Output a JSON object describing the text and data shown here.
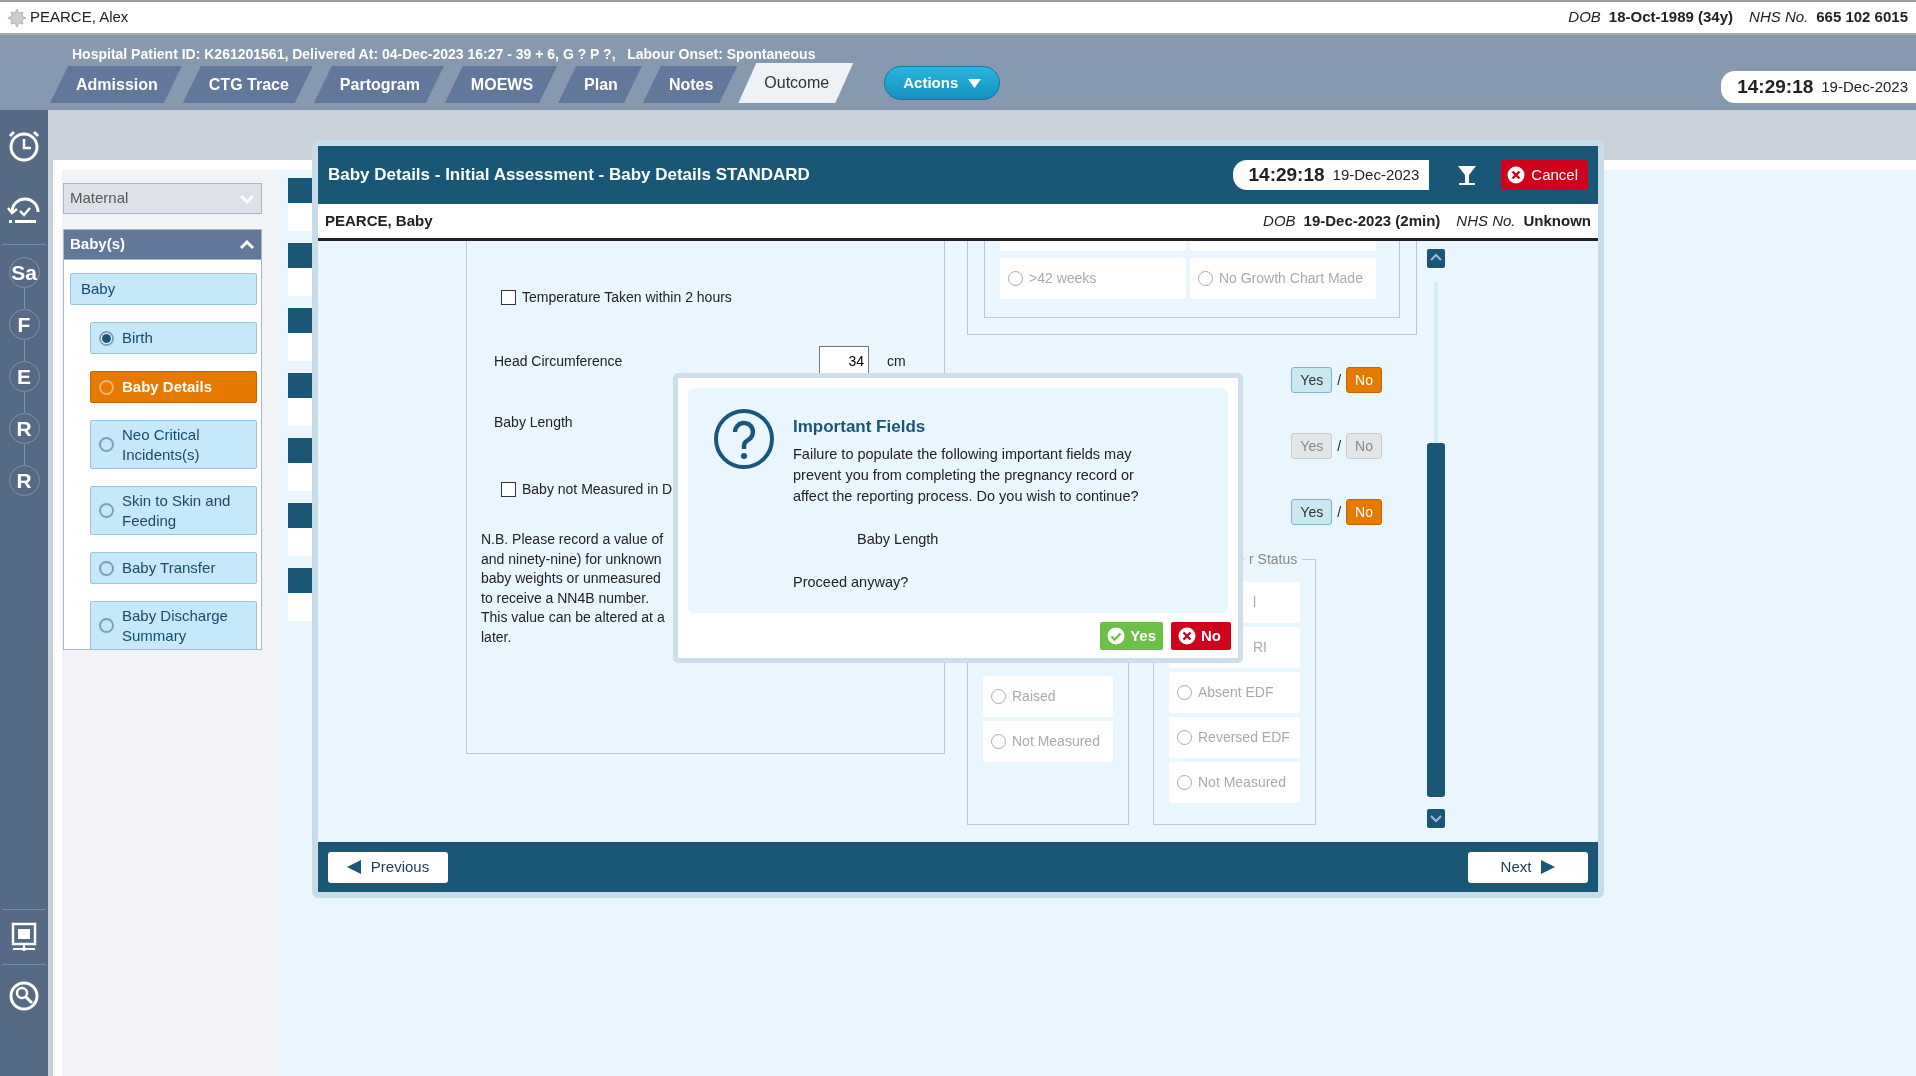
{
  "patient_bar": {
    "name": "PEARCE, Alex",
    "dob_label": "DOB",
    "dob": "18-Oct-1989 (34y)",
    "nhs_label": "NHS No.",
    "nhs": "665 102 6015"
  },
  "header": {
    "info": "Hospital Patient ID: K261201561, Delivered At: 04-Dec-2023 16:27 - 39 + 6, G ? P ?,   Labour Onset: Spontaneous",
    "tabs": [
      {
        "label": "Admission",
        "selected": false
      },
      {
        "label": "CTG Trace",
        "selected": false
      },
      {
        "label": "Partogram",
        "selected": false
      },
      {
        "label": "MOEWS",
        "selected": false
      },
      {
        "label": "Plan",
        "selected": false
      },
      {
        "label": "Notes",
        "selected": false
      },
      {
        "label": "Outcome",
        "selected": true
      }
    ],
    "actions": "Actions",
    "clock": {
      "time": "14:29:18",
      "date": "19-Dec-2023"
    }
  },
  "rail": {
    "steps": [
      "Sa",
      "F",
      "E",
      "R",
      "R"
    ]
  },
  "nav": {
    "sections": [
      {
        "label": "Maternal",
        "expanded": false
      },
      {
        "label": "Baby(s)",
        "expanded": true
      }
    ],
    "group": "Baby",
    "items": [
      {
        "label": "Birth",
        "checked": true,
        "selected": false
      },
      {
        "label": "Baby Details",
        "checked": false,
        "selected": true
      },
      {
        "label": "Neo Critical Incidents(s)",
        "checked": false,
        "selected": false
      },
      {
        "label": "Skin to Skin and Feeding",
        "checked": false,
        "selected": false
      },
      {
        "label": "Baby Transfer",
        "checked": false,
        "selected": false
      },
      {
        "label": "Baby Discharge Summary",
        "checked": false,
        "selected": false
      }
    ]
  },
  "wizard": {
    "title": "Baby Details - Initial Assessment - Baby Details STANDARD",
    "clock": {
      "time": "14:29:18",
      "date": "19-Dec-2023"
    },
    "cancel": "Cancel",
    "baby": {
      "name": "PEARCE, Baby",
      "dob_label": "DOB",
      "dob": "19-Dec-2023 (2min)",
      "nhs_label": "NHS No.",
      "nhs": "Unknown"
    },
    "form": {
      "temperature": {
        "label": "Temperature Taken within 2 hours",
        "checked": false
      },
      "head": {
        "label": "Head Circumference",
        "value": "34",
        "unit": "cm"
      },
      "length": {
        "label": "Baby Length"
      },
      "not_measured": {
        "label": "Baby not Measured in D",
        "checked": false
      },
      "note": [
        "N.B. Please record a value of",
        "and ninety-nine) for unknown",
        "baby weights or unmeasured",
        "to receive a NN4B number.",
        "This value can be altered at a",
        "later."
      ]
    },
    "growth_options": [
      {
        "label": ">42 weeks",
        "selected": false
      },
      {
        "label": "No Growth Chart Made",
        "selected": false
      }
    ],
    "toggles": [
      {
        "disabled": false,
        "separator": "/",
        "options": [
          {
            "label": "Yes",
            "selected": false
          },
          {
            "label": "No",
            "selected": true
          }
        ]
      },
      {
        "disabled": true,
        "separator": "/",
        "options": [
          {
            "label": "Yes",
            "selected": false
          },
          {
            "label": "No",
            "selected": false
          }
        ]
      },
      {
        "disabled": false,
        "separator": "/",
        "options": [
          {
            "label": "Yes",
            "selected": false
          },
          {
            "label": "No",
            "selected": true
          }
        ]
      }
    ],
    "group_a": {
      "options": [
        {
          "label": "Raised",
          "selected": false
        },
        {
          "label": "Not Measured",
          "selected": false
        }
      ]
    },
    "group_b": {
      "legend": "r Status",
      "options": [
        {
          "label": "l",
          "kind": "partial",
          "selected": false
        },
        {
          "label": "RI",
          "kind": "partial",
          "selected": false
        },
        {
          "label": "Absent EDF",
          "kind": "full",
          "selected": false
        },
        {
          "label": "Reversed EDF",
          "kind": "full",
          "selected": false
        },
        {
          "label": "Not Measured",
          "kind": "full",
          "selected": false
        }
      ]
    },
    "previous": "Previous",
    "next": "Next"
  },
  "dialog": {
    "title": "Important Fields",
    "message": "Failure to populate the following important fields may prevent you from completing the pregnancy record or affect the reporting process.  Do you wish to continue?",
    "field": "Baby Length",
    "prompt": "Proceed anyway?",
    "yes": "Yes",
    "no": "No"
  }
}
